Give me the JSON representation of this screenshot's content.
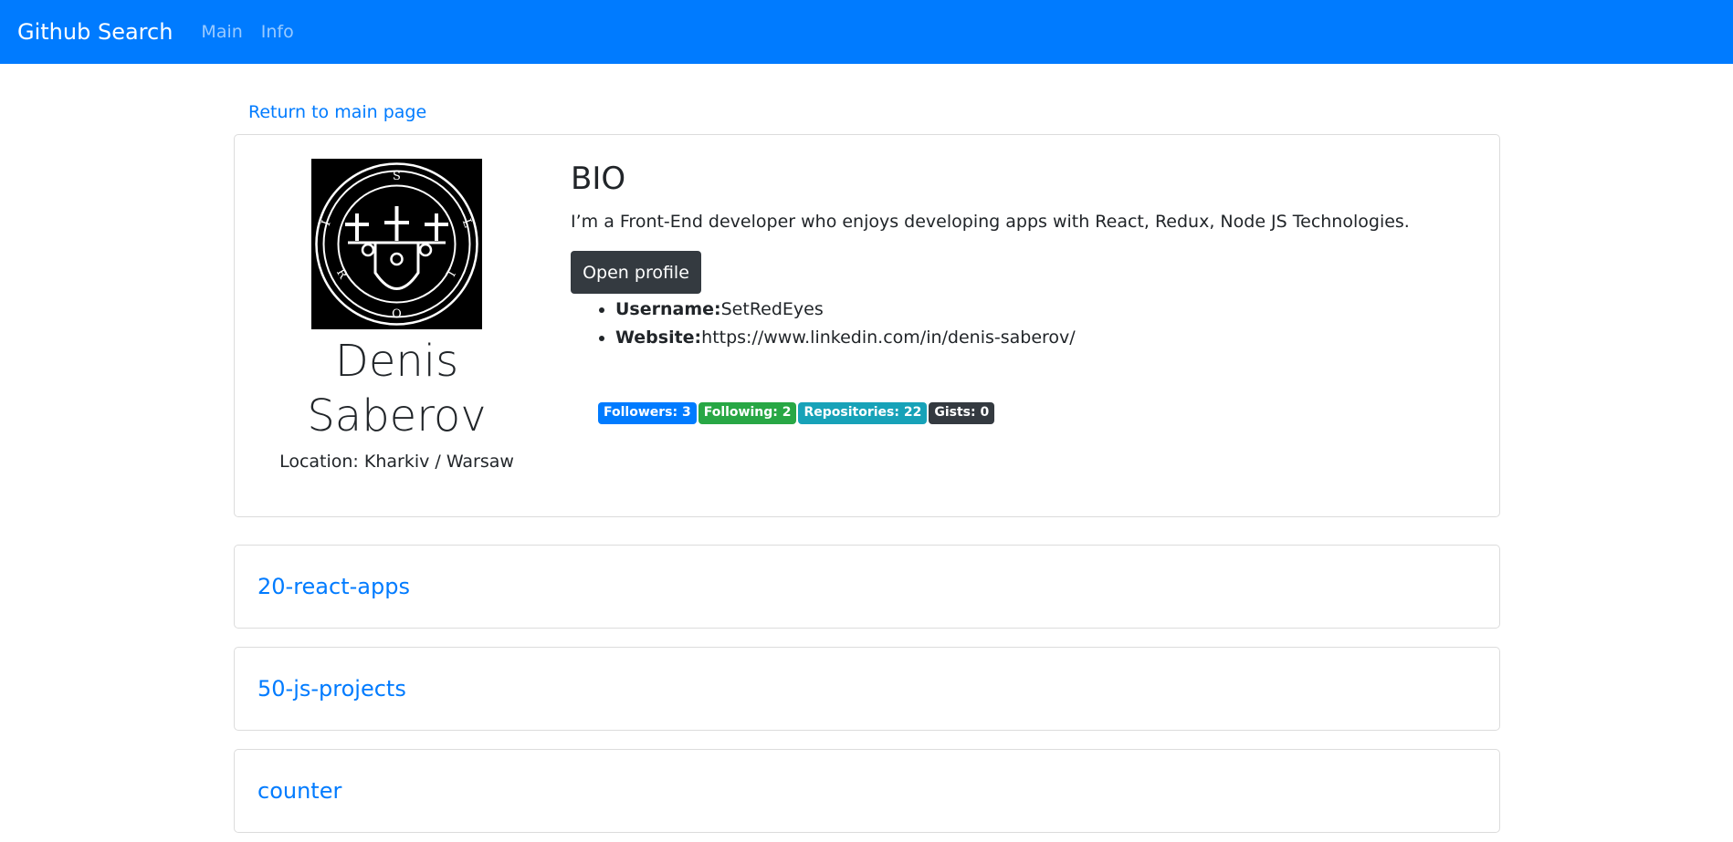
{
  "navbar": {
    "brand": "Github Search",
    "links": [
      "Main",
      "Info"
    ]
  },
  "return_link": "Return to main page",
  "profile": {
    "avatar_icon": "sigil-avatar-icon",
    "name": "Denis Saberov",
    "location": "Location: Kharkiv / Warsaw",
    "bio_heading": "BIO",
    "bio": "I’m a Front-End developer who enjoys developing apps with React, Redux, Node JS Technologies.",
    "open_profile_label": "Open profile",
    "username_label": "Username:",
    "username": "SetRedEyes",
    "website_label": "Website:",
    "website": "https://www.linkedin.com/in/denis-saberov/"
  },
  "badges": [
    {
      "label": "Followers: 3",
      "color": "#007bff"
    },
    {
      "label": "Following: 2",
      "color": "#28a745"
    },
    {
      "label": "Repositories: 22",
      "color": "#17a2b8"
    },
    {
      "label": "Gists: 0",
      "color": "#343a40"
    }
  ],
  "repos": [
    "20-react-apps",
    "50-js-projects",
    "counter"
  ],
  "colors": {
    "primary": "#007bff",
    "dark": "#343a40"
  }
}
